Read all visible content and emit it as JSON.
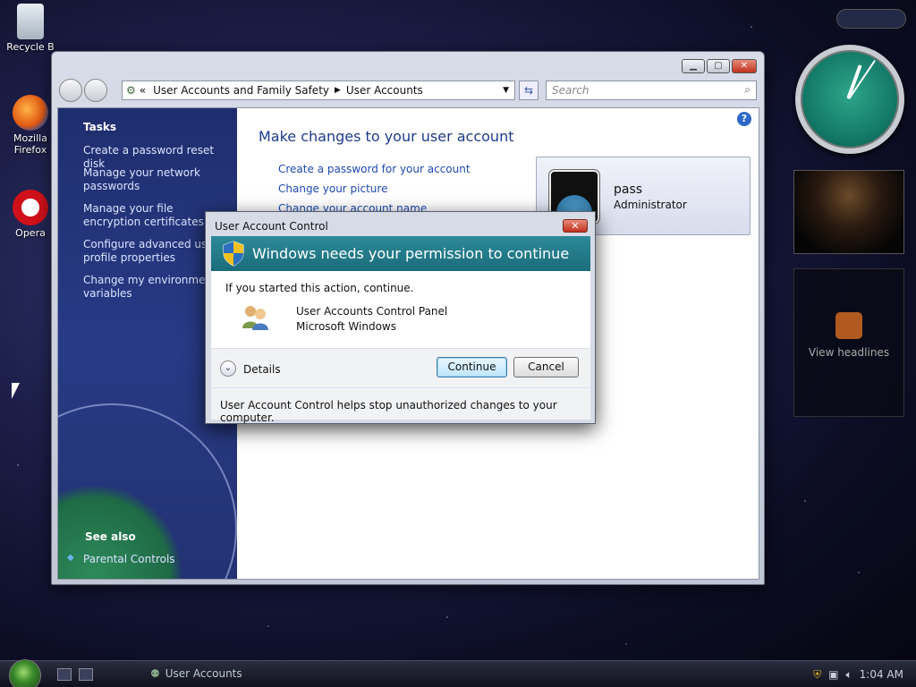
{
  "desktop": {
    "icons": [
      {
        "label": "Recycle B"
      },
      {
        "label": "Mozilla Firefox"
      },
      {
        "label": "Opera"
      }
    ],
    "gadgets": {
      "feed_label": "View headlines"
    }
  },
  "window": {
    "breadcrumb_prefix": "«",
    "breadcrumb": [
      "User Accounts and Family Safety",
      "User Accounts"
    ],
    "search_placeholder": "Search",
    "tasks_title": "Tasks",
    "tasks": [
      "Create a password reset disk",
      "Manage your network passwords",
      "Manage your file encryption certificates",
      "Configure advanced user profile properties",
      "Change my environment variables"
    ],
    "see_also": "See also",
    "parental_controls": "Parental Controls",
    "heading": "Make changes to your user account",
    "links": [
      "Create a password for your account",
      "Change your picture",
      "Change your account name"
    ],
    "user": {
      "name": "pass",
      "role": "Administrator"
    }
  },
  "uac": {
    "title": "User Account Control",
    "banner": "Windows needs your permission to continue",
    "intro": "If you started this action, continue.",
    "program_name": "User Accounts Control Panel",
    "publisher": "Microsoft Windows",
    "details_label": "Details",
    "continue_label": "Continue",
    "cancel_label": "Cancel",
    "footer": "User Account Control helps stop unauthorized changes to your computer."
  },
  "taskbar": {
    "task_label": "User Accounts",
    "time": "1:04 AM"
  },
  "colors": {
    "banner": "#1b6c7a",
    "taskpane": "#283a85",
    "link": "#1e4ab0"
  }
}
